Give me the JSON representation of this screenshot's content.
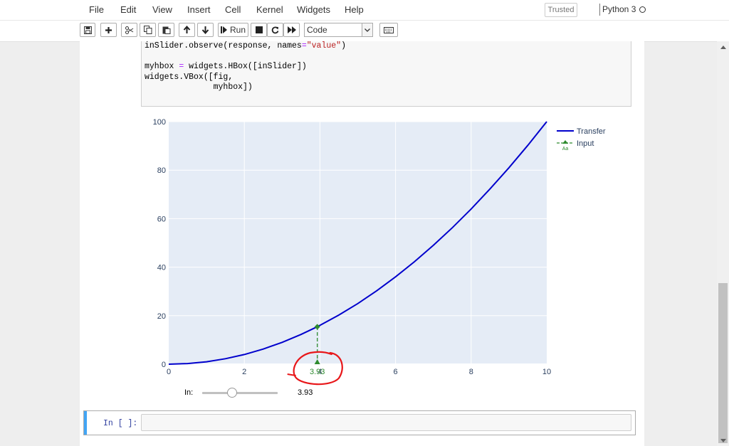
{
  "menu": {
    "items": [
      "File",
      "Edit",
      "View",
      "Insert",
      "Cell",
      "Kernel",
      "Widgets",
      "Help"
    ],
    "trusted": "Trusted",
    "kernel": "Python 3"
  },
  "toolbar": {
    "run_label": "Run",
    "cell_type": "Code",
    "buttons": [
      "save-icon",
      "plus-icon",
      "cut-icon",
      "copy-icon",
      "paste-icon",
      "arrow-up-icon",
      "arrow-down-icon",
      "run-icon",
      "stop-icon",
      "restart-icon",
      "fast-forward-icon",
      "keyboard-icon"
    ]
  },
  "code": {
    "line1_a": "inSlider.observe(response, names",
    "line1_op": "=",
    "line1_str": "\"value\"",
    "line1_b": ")",
    "line2": "",
    "line3_a": "myhbox ",
    "line3_op": "=",
    "line3_b": " widgets.HBox([inSlider])",
    "line4": "widgets.VBox([fig,",
    "line5": "              myhbox])"
  },
  "chart_data": {
    "type": "line",
    "x_ticks": [
      "0",
      "2",
      "4",
      "6",
      "8",
      "10"
    ],
    "y_ticks": [
      "0",
      "20",
      "40",
      "60",
      "80",
      "100"
    ],
    "xlim": [
      0,
      10
    ],
    "ylim": [
      0,
      100
    ],
    "grid": true,
    "legend_position": "top-right",
    "series": [
      {
        "name": "Transfer",
        "color": "#0000cc",
        "x": [
          0,
          0.5,
          1,
          1.5,
          2,
          2.5,
          3,
          3.5,
          3.93,
          4,
          4.5,
          5,
          5.5,
          6,
          6.5,
          7,
          7.5,
          8,
          8.5,
          9,
          9.5,
          10
        ],
        "y": [
          0,
          0.25,
          1,
          2.25,
          4,
          6.25,
          9,
          12.25,
          15.44,
          16,
          20.25,
          25,
          30.25,
          36,
          42.25,
          49,
          56.25,
          64,
          72.25,
          81,
          90.25,
          100
        ]
      },
      {
        "name": "Input",
        "color": "#2e8b2e",
        "style": "dashed",
        "x": [
          3.93,
          3.93
        ],
        "y": [
          0,
          15.44
        ],
        "annotation": "3.93",
        "legend_icon_text": "Aa"
      }
    ]
  },
  "slider": {
    "label": "In:",
    "value": 3.93,
    "min": 0,
    "max": 10,
    "readout": "3.93"
  },
  "empty_cell": {
    "prompt": "In [ ]:"
  },
  "colors": {
    "plot_bg": "#e5ecf6",
    "annotation_circle": "#e8171a",
    "cell_selected": "#42a5f5"
  }
}
